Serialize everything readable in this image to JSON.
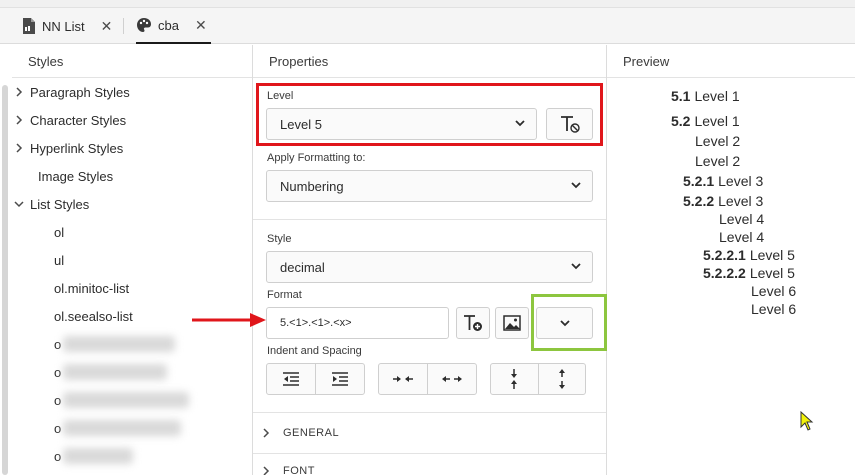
{
  "tabs": [
    {
      "label": "NN List",
      "icon": "document-icon",
      "active": false
    },
    {
      "label": "cba",
      "icon": "palette-icon",
      "active": true
    }
  ],
  "close_glyph": "✕",
  "styles_panel": {
    "header": "Styles",
    "items": [
      {
        "label": "Paragraph Styles",
        "expandable": true
      },
      {
        "label": "Character Styles",
        "expandable": true
      },
      {
        "label": "Hyperlink Styles",
        "expandable": true
      },
      {
        "label": "Image Styles",
        "expandable": false
      },
      {
        "label": "List Styles",
        "expandable": true,
        "expanded": true
      }
    ],
    "list_children": [
      "ol",
      "ul",
      "ol.minitoc-list",
      "ol.seealso-list"
    ],
    "blurred_children": [
      "o",
      "o",
      "o",
      "o",
      "o"
    ]
  },
  "properties_panel": {
    "header": "Properties",
    "level_label": "Level",
    "level_value": "Level 5",
    "apply_label": "Apply Formatting to:",
    "apply_value": "Numbering",
    "style_label": "Style",
    "style_value": "decimal",
    "format_label": "Format",
    "format_value": "5.<1>.<1>.<x>",
    "indent_label": "Indent and Spacing",
    "section_general": "GENERAL",
    "section_font": "FONT"
  },
  "preview_panel": {
    "header": "Preview",
    "lines": [
      {
        "num": "5.1",
        "text": "Level 1"
      },
      {
        "num": "5.2",
        "text": "Level 1"
      },
      {
        "num": "",
        "text": "Level 2"
      },
      {
        "num": "",
        "text": "Level 2"
      },
      {
        "num": "5.2.1",
        "text": "Level 3"
      },
      {
        "num": "5.2.2",
        "text": "Level 3"
      },
      {
        "num": "",
        "text": "Level 4"
      },
      {
        "num": "",
        "text": "Level 4"
      },
      {
        "num": "5.2.2.1",
        "text": "Level 5"
      },
      {
        "num": "5.2.2.2",
        "text": "Level 5"
      },
      {
        "num": "",
        "text": "Level 6"
      },
      {
        "num": "",
        "text": "Level 6"
      }
    ]
  },
  "colors": {
    "annotation_red": "#e0161b",
    "annotation_green": "#8dc63f",
    "cursor_yellow": "#f2f20a"
  }
}
